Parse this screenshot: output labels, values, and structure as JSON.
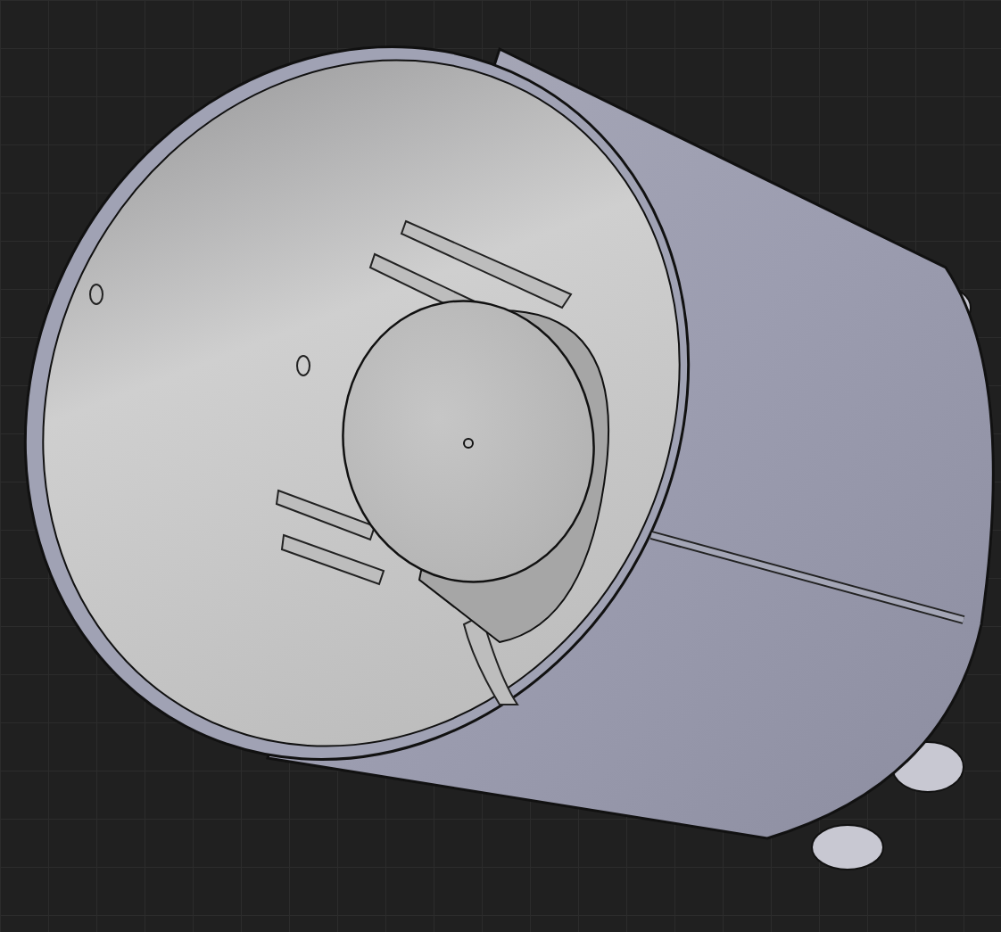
{
  "viewport": {
    "kind": "cad-model"
  }
}
